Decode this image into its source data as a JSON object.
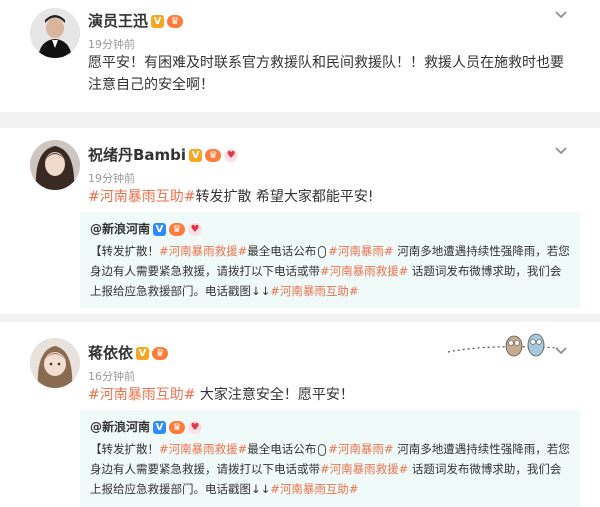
{
  "posts": [
    {
      "author": "演员王迅",
      "time": "19分钟前",
      "text": "愿平安！有困难及时联系官方救援队和民间救援队！！救援人员在施救时也要注意自己的安全啊！"
    },
    {
      "author": "祝绪丹Bambi",
      "time": "19分钟前",
      "hashtag": "#河南暴雨互助#",
      "text": "转发扩散 希望大家都能平安!",
      "repost": {
        "author": "@新浪河南",
        "lead": "【转发扩散！",
        "tag1": "#河南暴雨救援#",
        "after_tag1": "最全电话公布",
        "tag2": "#河南暴雨#",
        "mid1": " 河南多地遭遇持续性强降雨，若您身边有人需要紧急救援，请拨打以下电话或带",
        "tag3": "#河南暴雨救援#",
        "mid2": " 话题词发布微博求助，我们会上报给应急救援部门。电话戳图↓↓",
        "tag4": "#河南暴雨互助#"
      }
    },
    {
      "author": "蒋依依",
      "time": "16分钟前",
      "hashtag": "#河南暴雨互助#",
      "text": " 大家注意安全！愿平安！",
      "repost": {
        "author": "@新浪河南",
        "lead": "【转发扩散！",
        "tag1": "#河南暴雨救援#",
        "after_tag1": "最全电话公布",
        "tag2": "#河南暴雨#",
        "mid1": " 河南多地遭遇持续性强降雨，若您身边有人需要紧急救援，请拨打以下电话或带",
        "tag3": "#河南暴雨救援#",
        "mid2": " 话题词发布微博求助，我们会上报给应急救援部门。电话戳图↓↓",
        "tag4": "#河南暴雨互助#"
      }
    }
  ],
  "badges": {
    "verified": "V",
    "crown": "♛",
    "gift": "♥"
  },
  "colors": {
    "hashtag": "#eb7350",
    "repost_bg": "#f0faf8",
    "time": "#999999",
    "verified_gold": "#f6a623",
    "verified_blue": "#2f8cff"
  }
}
